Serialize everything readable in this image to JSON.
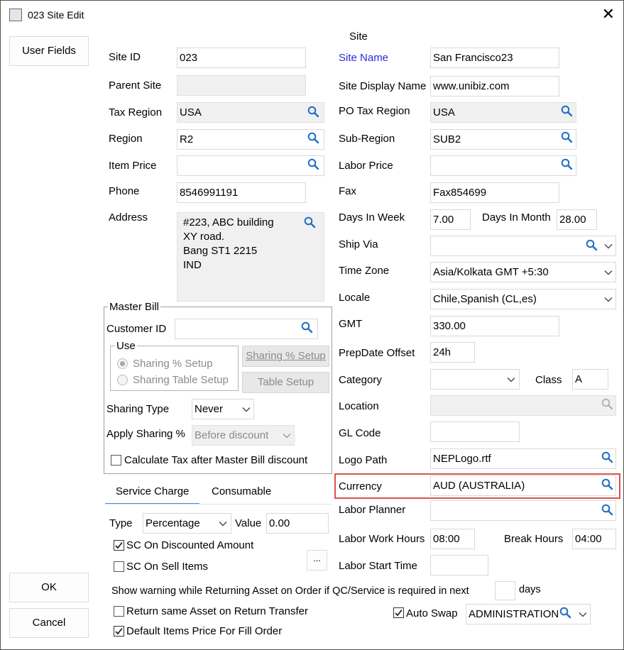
{
  "window": {
    "title": "023 Site Edit",
    "close_glyph": "✕"
  },
  "left_buttons": {
    "user_fields": "User Fields",
    "ok": "OK",
    "cancel": "Cancel"
  },
  "section_title": "Site",
  "left": {
    "site_id": {
      "label": "Site ID",
      "value": "023"
    },
    "parent_site": {
      "label": "Parent Site",
      "value": ""
    },
    "tax_region": {
      "label": "Tax Region",
      "value": "USA"
    },
    "region": {
      "label": "Region",
      "value": "R2"
    },
    "item_price": {
      "label": "Item Price",
      "value": ""
    },
    "phone": {
      "label": "Phone",
      "value": "8546991191"
    },
    "address": {
      "label": "Address",
      "lines": [
        "#223, ABC building",
        "XY road.",
        "Bang ST1 2215",
        "IND"
      ]
    }
  },
  "master_bill": {
    "title": "Master Bill",
    "customer_id_label": "Customer ID",
    "customer_id_value": "",
    "use_title": "Use",
    "radio_sharing_pct": "Sharing % Setup",
    "radio_sharing_table": "Sharing Table Setup",
    "btn_sharing_pct": "Sharing % Setup",
    "btn_table_setup": "Table Setup",
    "sharing_type_label": "Sharing Type",
    "sharing_type_value": "Never",
    "apply_sharing_label": "Apply Sharing %",
    "apply_sharing_value": "Before discount",
    "calc_tax_label": "Calculate Tax after Master Bill discount"
  },
  "tabs": {
    "service_charge": "Service Charge",
    "consumable": "Consumable"
  },
  "service_charge": {
    "type_label": "Type",
    "type_value": "Percentage",
    "value_label": "Value",
    "value_value": "0.00",
    "sc_discounted": "SC On Discounted Amount",
    "sc_sell_items": "SC On Sell Items",
    "ellipsis": "..."
  },
  "right": {
    "site_name": {
      "label": "Site Name",
      "value": "San Francisco23"
    },
    "site_display_name": {
      "label": "Site Display Name",
      "value": "www.unibiz.com"
    },
    "po_tax_region": {
      "label": "PO Tax Region",
      "value": "USA"
    },
    "sub_region": {
      "label": "Sub-Region",
      "value": "SUB2"
    },
    "labor_price": {
      "label": "Labor Price",
      "value": ""
    },
    "fax": {
      "label": "Fax",
      "value": "Fax854699"
    },
    "days_in_week": {
      "label": "Days In Week",
      "value": "7.00"
    },
    "days_in_month": {
      "label": "Days In Month",
      "value": "28.00"
    },
    "ship_via": {
      "label": "Ship Via",
      "value": ""
    },
    "time_zone": {
      "label": "Time Zone",
      "value": "Asia/Kolkata GMT +5:30"
    },
    "locale": {
      "label": "Locale",
      "value": "Chile,Spanish (CL,es)"
    },
    "gmt": {
      "label": "GMT",
      "value": "330.00"
    },
    "prepdate_offset": {
      "label": "PrepDate Offset",
      "value": "24h"
    },
    "category": {
      "label": "Category",
      "value": ""
    },
    "class": {
      "label": "Class",
      "value": "A"
    },
    "location": {
      "label": "Location",
      "value": ""
    },
    "gl_code": {
      "label": "GL Code",
      "value": ""
    },
    "logo_path": {
      "label": "Logo Path",
      "value": "NEPLogo.rtf"
    },
    "currency": {
      "label": "Currency",
      "value": "AUD (AUSTRALIA)"
    },
    "labor_planner": {
      "label": "Labor Planner",
      "value": ""
    },
    "labor_work_hours": {
      "label": "Labor Work Hours",
      "value": "08:00"
    },
    "break_hours": {
      "label": "Break Hours",
      "value": "04:00"
    },
    "labor_start_time": {
      "label": "Labor Start Time",
      "value": ""
    }
  },
  "bottom": {
    "warning_text": "Show warning while Returning Asset on Order if QC/Service is required in next",
    "warning_days_value": "",
    "days_label": "days",
    "return_same_asset": "Return same Asset on Return Transfer",
    "default_items_price": "Default Items Price For Fill Order",
    "auto_swap": "Auto Swap",
    "auto_swap_value": "ADMINISTRATION"
  },
  "colors": {
    "link_label": "#2b2bd8",
    "highlight": "#d9534f",
    "tab_accent": "#3c8ddc",
    "search_icon": "#1f6fc6"
  }
}
